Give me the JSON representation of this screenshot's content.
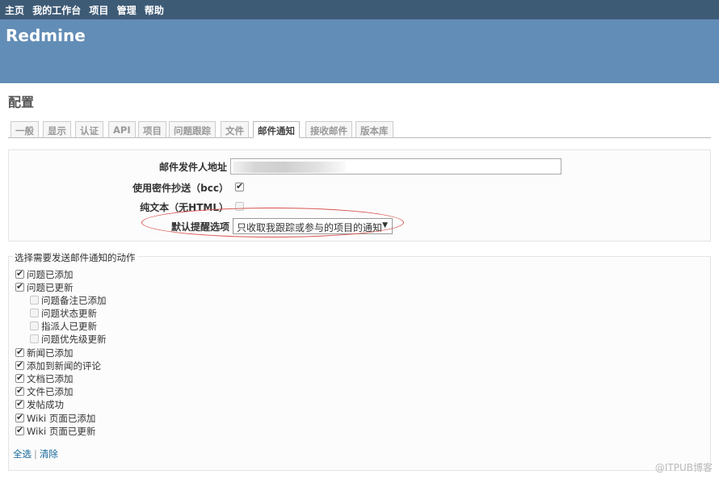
{
  "top_menu": [
    "主页",
    "我的工作台",
    "项目",
    "管理",
    "帮助"
  ],
  "app_title": "Redmine",
  "page_title": "配置",
  "tabs": [
    "一般",
    "显示",
    "认证",
    "API",
    "项目",
    "问题跟踪",
    "文件",
    "邮件通知",
    "接收邮件",
    "版本库"
  ],
  "selected_tab": "邮件通知",
  "settings": {
    "from_label": "邮件发件人地址",
    "bcc_label": "使用密件抄送（bcc）",
    "bcc_checked": true,
    "plain_label": "纯文本（无HTML）",
    "plain_checked": false,
    "default_notif_label": "默认提醒选项",
    "default_notif_value": "只收取我跟踪或参与的项目的通知"
  },
  "actions_legend": "选择需要发送邮件通知的动作",
  "actions": [
    {
      "label": "问题已添加",
      "checked": true,
      "indent": false
    },
    {
      "label": "问题已更新",
      "checked": true,
      "indent": false
    },
    {
      "label": "问题备注已添加",
      "checked": false,
      "indent": true
    },
    {
      "label": "问题状态更新",
      "checked": false,
      "indent": true
    },
    {
      "label": "指派人已更新",
      "checked": false,
      "indent": true
    },
    {
      "label": "问题优先级更新",
      "checked": false,
      "indent": true
    },
    {
      "label": "新闻已添加",
      "checked": true,
      "indent": false
    },
    {
      "label": "添加到新闻的评论",
      "checked": true,
      "indent": false
    },
    {
      "label": "文档已添加",
      "checked": true,
      "indent": false
    },
    {
      "label": "文件已添加",
      "checked": true,
      "indent": false
    },
    {
      "label": "发帖成功",
      "checked": true,
      "indent": false
    },
    {
      "label": "Wiki 页面已添加",
      "checked": true,
      "indent": false
    },
    {
      "label": "Wiki 页面已更新",
      "checked": true,
      "indent": false
    }
  ],
  "links": {
    "check_all": "全选",
    "separator": "|",
    "clear": "清除"
  },
  "watermark": "@ITPUB博客"
}
